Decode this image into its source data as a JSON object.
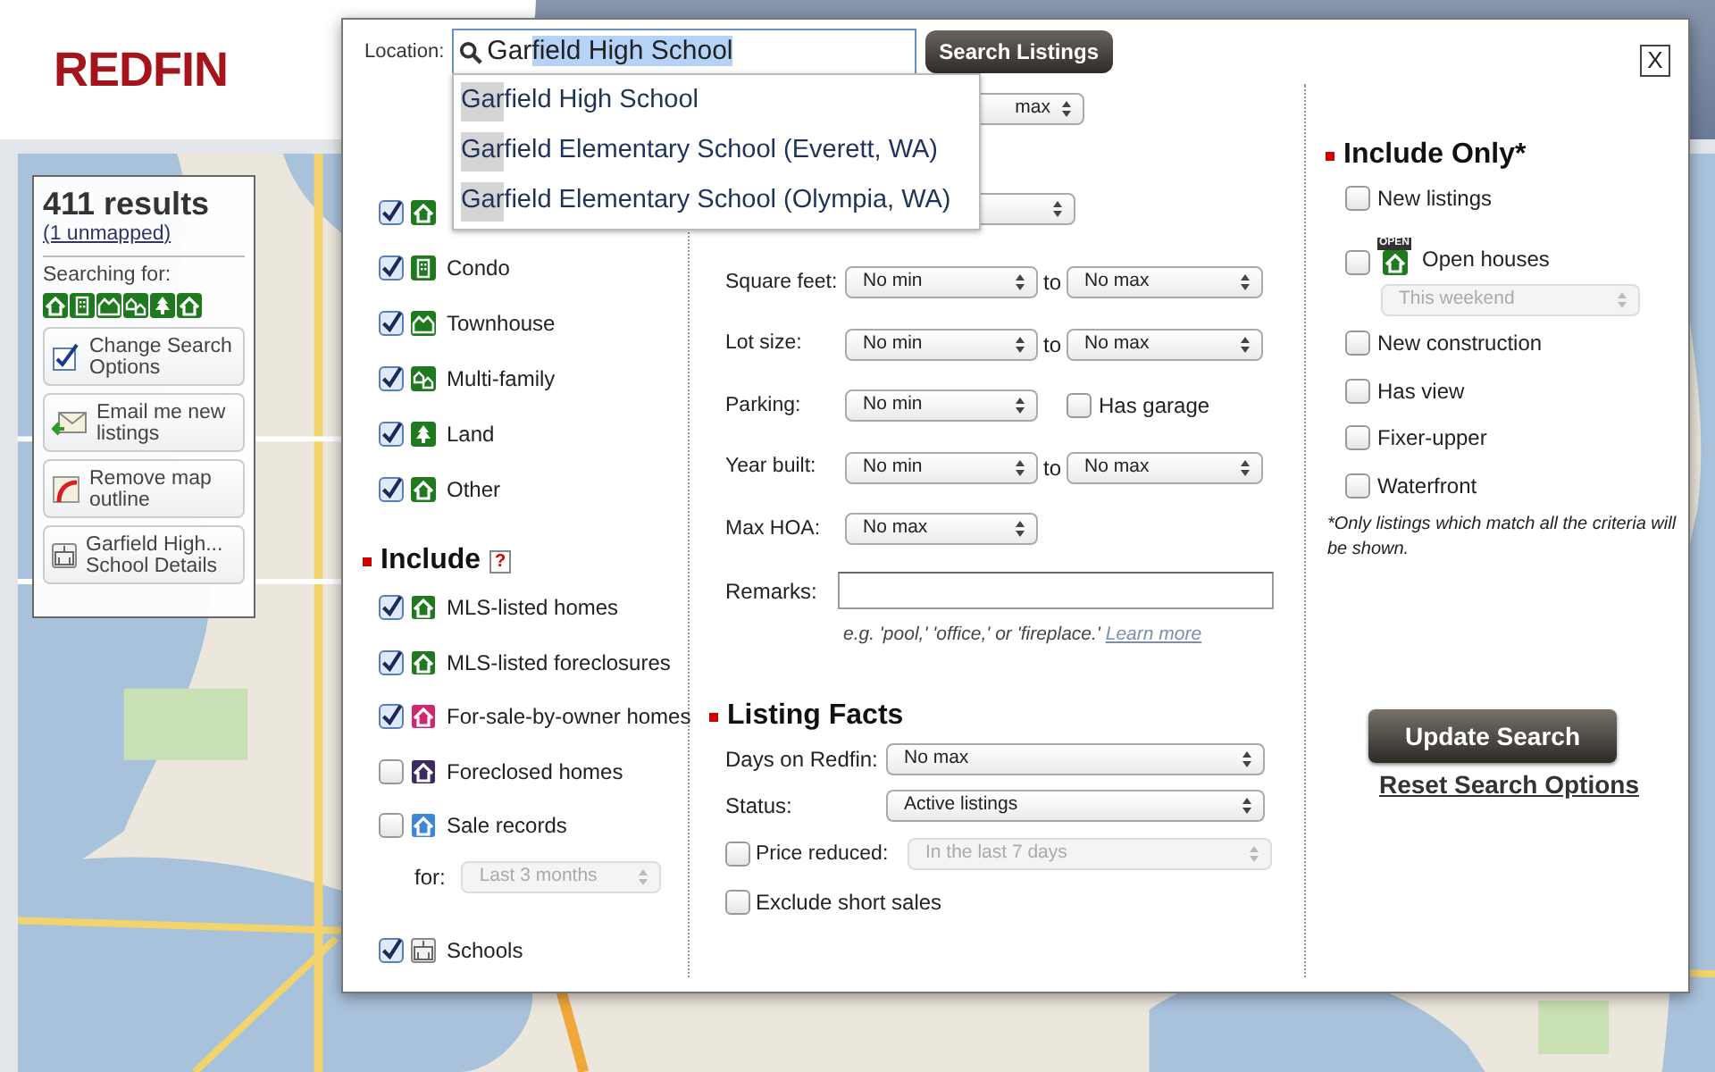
{
  "header": {
    "logo": "REDFIN"
  },
  "results_panel": {
    "count": "411 results",
    "unmapped": "(1 unmapped)",
    "searching_for": "Searching for:",
    "actions": [
      {
        "kind": "options",
        "label": "Change Search Options"
      },
      {
        "kind": "email",
        "label": "Email me new listings"
      },
      {
        "kind": "outline",
        "label": "Remove map outline"
      },
      {
        "kind": "school",
        "label": "Garfield High... School Details"
      }
    ]
  },
  "search": {
    "label": "Location:",
    "typed": "Gar",
    "completed": "field High School",
    "button": "Search Listings",
    "close": "X",
    "suggestions": [
      {
        "match": "Gar",
        "rest": "field High School"
      },
      {
        "match": "Gar",
        "rest": "field Elementary School (Everett, WA)"
      },
      {
        "match": "Gar",
        "rest": "field Elementary School (Olympia, WA)"
      }
    ]
  },
  "property_types": [
    {
      "kind": "house",
      "checked": true
    },
    {
      "kind": "condo",
      "label": "Condo",
      "checked": true
    },
    {
      "kind": "townhouse",
      "label": "Townhouse",
      "checked": true
    },
    {
      "kind": "multi",
      "label": "Multi-family",
      "checked": true
    },
    {
      "kind": "land",
      "label": "Land",
      "checked": true
    },
    {
      "kind": "house",
      "label": "Other",
      "checked": true
    }
  ],
  "include": {
    "title": "Include",
    "help": "?",
    "items": [
      {
        "label": "MLS-listed homes",
        "checked": true,
        "color": "#1f7a1f"
      },
      {
        "label": "MLS-listed foreclosures",
        "checked": true,
        "color": "#1f7a1f"
      },
      {
        "label": "For-sale-by-owner homes",
        "checked": true,
        "color": "#d0286e"
      },
      {
        "label": "Foreclosed homes",
        "checked": false,
        "color": "#3b2a63"
      },
      {
        "label": "Sale records",
        "checked": false,
        "color": "#3d86d9"
      }
    ],
    "for_label": "for:",
    "for_value": "Last 3 months",
    "for_disabled": true
  },
  "schools": {
    "label": "Schools",
    "checked": true
  },
  "price_max": "max",
  "filters": [
    {
      "kind": "range",
      "label": "Square feet:",
      "min": "No min",
      "to": "to",
      "max": "No max"
    },
    {
      "kind": "range",
      "label": "Lot size:",
      "min": "No min",
      "to": "to",
      "max": "No max"
    },
    {
      "kind": "garage",
      "label": "Parking:",
      "min": "No min",
      "option": "Has garage",
      "checked": false
    },
    {
      "kind": "range",
      "label": "Year built:",
      "min": "No min",
      "to": "to",
      "max": "No max"
    },
    {
      "kind": "single",
      "label": "Max HOA:",
      "min": "No max"
    }
  ],
  "remarks": {
    "label": "Remarks:",
    "hint": "e.g. 'pool,' 'office,' or 'fireplace.'",
    "link": "Learn more"
  },
  "listing_facts": {
    "title": "Listing Facts",
    "days": {
      "label": "Days on Redfin:",
      "value": "No max"
    },
    "status": {
      "label": "Status:",
      "value": "Active listings"
    },
    "price_reduced": {
      "label": "Price reduced:",
      "checked": false,
      "value": "In the last 7 days",
      "disabled": true
    },
    "short_sales": {
      "label": "Exclude short sales",
      "checked": false
    }
  },
  "include_only": {
    "title": "Include Only*",
    "items": [
      {
        "kind": "plain",
        "label": "New listings",
        "checked": false
      },
      {
        "kind": "open",
        "label": "Open houses",
        "checked": false,
        "badge": "OPEN",
        "select": "This weekend",
        "disabled": true
      },
      {
        "kind": "plain",
        "label": "New construction",
        "checked": false
      },
      {
        "kind": "plain",
        "label": "Has view",
        "checked": false
      },
      {
        "kind": "plain",
        "label": "Fixer-upper",
        "checked": false
      },
      {
        "kind": "plain",
        "label": "Waterfront",
        "checked": false
      }
    ],
    "note": "*Only listings which match all the criteria will be shown."
  },
  "buttons": {
    "update": "Update Search",
    "reset": "Reset Search Options"
  }
}
